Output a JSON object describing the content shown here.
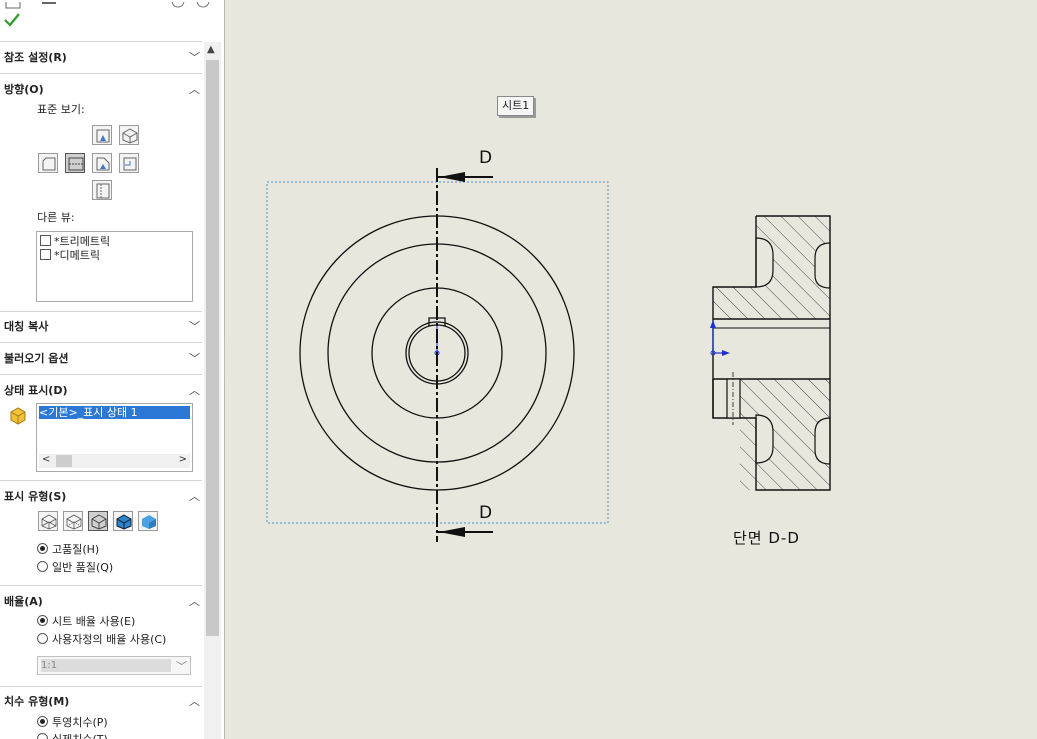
{
  "panel": {
    "sections": [
      {
        "title": "참조 설정(R)",
        "collapsed": true
      },
      {
        "title": "방향(O)",
        "collapsed": false
      },
      {
        "title": "대칭 복사",
        "collapsed": true
      },
      {
        "title": "불러오기 옵션",
        "collapsed": true
      },
      {
        "title": "상태 표시(D)",
        "collapsed": false
      },
      {
        "title": "표시 유형(S)",
        "collapsed": false
      },
      {
        "title": "배율(A)",
        "collapsed": false
      },
      {
        "title": "치수 유형(M)",
        "collapsed": false
      }
    ],
    "orientation": {
      "standard_views_label": "표준 보기:",
      "more_views_label": "다른 뷰:",
      "more_views": [
        "*트리메트릭",
        "*디메트릭"
      ]
    },
    "display_state": {
      "selected_item": "<기본>_표시 상태 1"
    },
    "display_style": {
      "quality_options": [
        {
          "label": "고품질(H)",
          "selected": true
        },
        {
          "label": "일반 품질(Q)",
          "selected": false
        }
      ]
    },
    "scale": {
      "options": [
        {
          "label": "시트 배율 사용(E)",
          "selected": true
        },
        {
          "label": "사용자정의 배율 사용(C)",
          "selected": false
        }
      ],
      "custom_value": "1:1"
    },
    "dimension_type": {
      "options": [
        {
          "label": "투영치수(P)",
          "selected": true
        },
        {
          "label": "실제치수(T)",
          "selected": false
        }
      ]
    }
  },
  "canvas": {
    "sheet_tab": "시트1",
    "section_cut_letter_top": "D",
    "section_cut_letter_bottom": "D",
    "section_view_label": "단면 D-D"
  },
  "colors": {
    "ok_check": "#2e9b2e",
    "selection": "#2b78d6",
    "sketch_blue": "#1f2fd6",
    "canvas_bg": "#e8e7de"
  }
}
